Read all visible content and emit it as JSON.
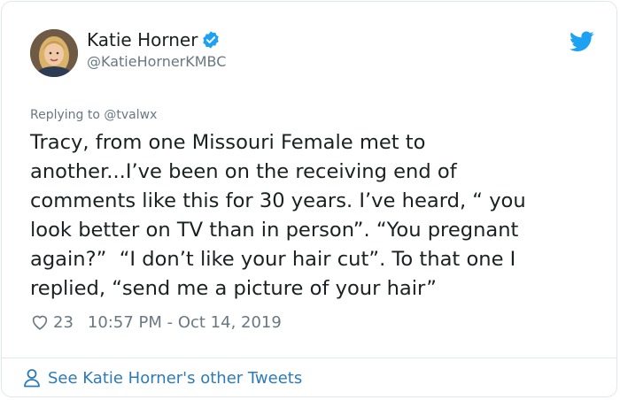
{
  "author": {
    "name": "Katie Horner",
    "handle": "@KatieHornerKMBC",
    "avatar_icon": "profile-photo",
    "verified_icon": "verified-badge-icon"
  },
  "reply": {
    "prefix": "Replying to ",
    "mention": "@tvalwx"
  },
  "tweet": {
    "text": "Tracy, from one Missouri Female met to\nanother...I’ve been on the receiving end of\ncomments like this for 30 years. I’ve heard, “ you\nlook better on TV than in person”. “You pregnant\nagain?”  “I don’t like your hair cut”. To that one I\nreplied, “send me a picture of your hair”"
  },
  "meta": {
    "likes": "23",
    "timestamp": "10:57 PM - Oct 14, 2019"
  },
  "footer": {
    "label": "See Katie Horner's other Tweets"
  },
  "colors": {
    "accent": "#1da1f2",
    "link": "#2b7bb9",
    "muted": "#697882",
    "text": "#1c2022"
  }
}
